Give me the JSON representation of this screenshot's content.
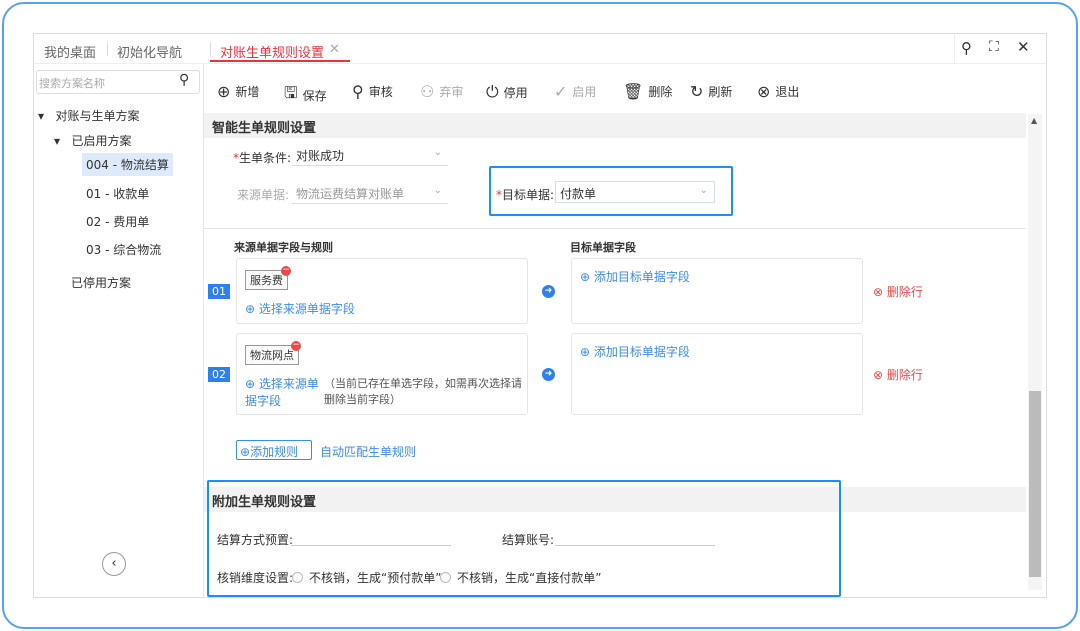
{
  "tabs": [
    {
      "label": "我的桌面"
    },
    {
      "label": "初始化导航"
    },
    {
      "label": "对账生单规则设置",
      "active": true
    }
  ],
  "window_icons": [
    "search-icon",
    "fullscreen-icon",
    "close-icon"
  ],
  "sidebar": {
    "search_placeholder": "搜索方案名称",
    "root": "对账与生单方案",
    "enabled_group": "已启用方案",
    "items": [
      "004 - 物流结算",
      "01 - 收款单",
      "02 - 费用单",
      "03 - 综合物流"
    ],
    "disabled_group": "已停用方案"
  },
  "toolbar": [
    {
      "label": "新增",
      "icon": "⊕"
    },
    {
      "label": "保存",
      "icon": "🖫"
    },
    {
      "label": "审核",
      "icon": "⚲"
    },
    {
      "label": "弃审",
      "icon": "⚇",
      "disabled": true
    },
    {
      "label": "停用",
      "icon": "⏻"
    },
    {
      "label": "启用",
      "icon": "✓",
      "disabled": true
    },
    {
      "label": "删除",
      "icon": "🗑"
    },
    {
      "label": "刷新",
      "icon": "↻"
    },
    {
      "label": "退出",
      "icon": "⊗"
    }
  ],
  "smart": {
    "title": "智能生单规则设置",
    "cond_label": "生单条件:",
    "cond_value": "对账成功",
    "source_label": "来源单据:",
    "source_value": "物流运费结算对账单",
    "target_label": "目标单据:",
    "target_value": "付款单"
  },
  "rules": {
    "source_header": "来源单据字段与规则",
    "target_header": "目标单据字段",
    "rows": [
      {
        "num": "01",
        "tag": "服务费",
        "select": "选择来源单据字段",
        "hint": "",
        "add_target": "添加目标单据字段",
        "delete": "删除行"
      },
      {
        "num": "02",
        "tag": "物流网点",
        "select": "选择来源单据字段",
        "hint": "（当前已存在单选字段，如需再次选择请删除当前字段）",
        "add_target": "添加目标单据字段",
        "delete": "删除行"
      }
    ],
    "add_rule": "添加规则",
    "auto_match": "自动匹配生单规则"
  },
  "extra": {
    "title": "附加生单规则设置",
    "settle_label": "结算方式预置:",
    "account_label": "结算账号:",
    "verify_label": "核销维度设置:",
    "opt1": "不核销，生成“预付款单”",
    "opt2": "不核销，生成“直接付款单”"
  },
  "colors": {
    "accent": "#2f80ed",
    "active_tab": "#f0323c",
    "highlight": "#1890ff"
  }
}
